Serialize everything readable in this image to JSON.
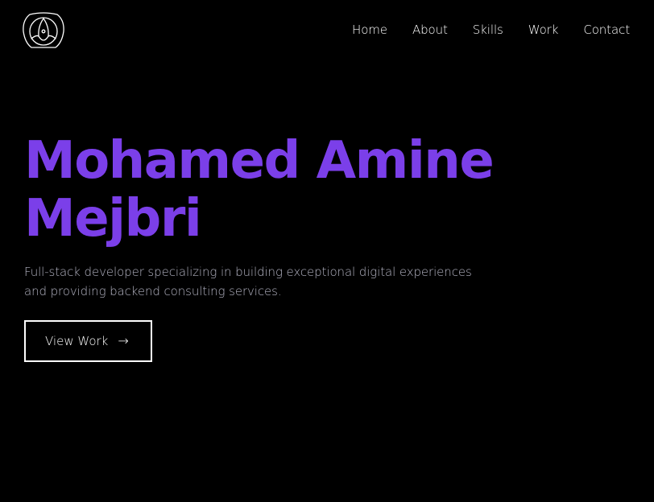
{
  "nav": {
    "logo_icon": "abstract-logo-icon",
    "links": [
      {
        "label": "Home"
      },
      {
        "label": "About"
      },
      {
        "label": "Skills"
      },
      {
        "label": "Work"
      },
      {
        "label": "Contact"
      }
    ]
  },
  "hero": {
    "title_line1": "Mohamed Amine",
    "title_line2": "Mejbri",
    "subtitle": "Full-stack developer specializing in building exceptional digital experiences and providing backend consulting services.",
    "cta_label": "View Work",
    "cta_icon": "arrow-right-icon",
    "cta_arrow": "→"
  },
  "colors": {
    "background": "#000000",
    "accent": "#7b3fe9",
    "text": "#ffffff",
    "muted": "#b4b4c3"
  }
}
